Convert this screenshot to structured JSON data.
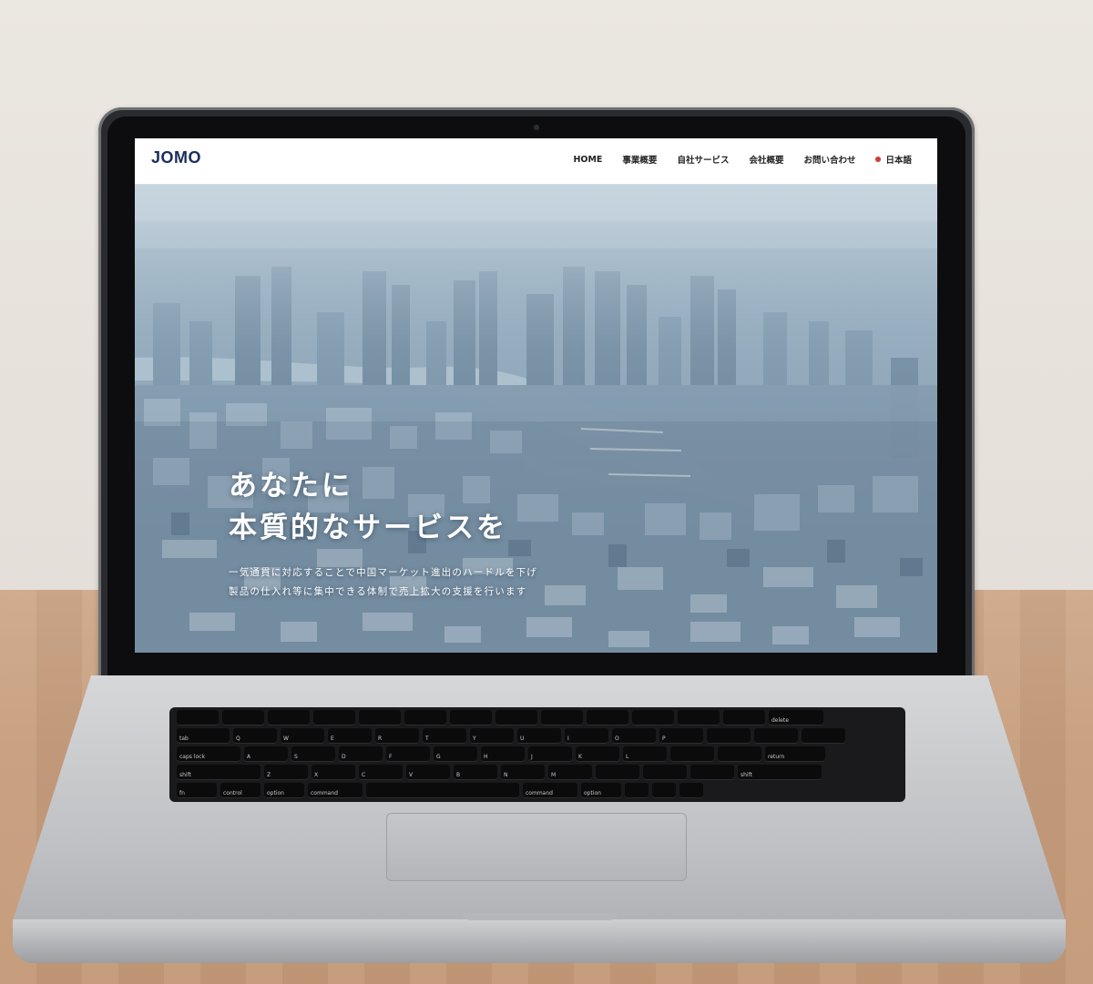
{
  "site": {
    "logo": "JOMO",
    "nav": [
      {
        "label": "HOME"
      },
      {
        "label": "事業概要"
      },
      {
        "label": "自社サービス"
      },
      {
        "label": "会社概要"
      },
      {
        "label": "お問い合わせ"
      }
    ],
    "language": {
      "label": "日本語",
      "flag_icon": "japan-flag-icon"
    }
  },
  "hero": {
    "title_line1": "あなたに",
    "title_line2": "本質的なサービスを",
    "subtitle_line1": "一気通貫に対応することで中国マーケット進出のハードルを下げ",
    "subtitle_line2": "製品の仕入れ等に集中できる体制で売上拡大の支援を行います"
  },
  "keyboard": {
    "row1": [
      "",
      "",
      "",
      "",
      "",
      "",
      "",
      "",
      "",
      "",
      "",
      "",
      "",
      "delete"
    ],
    "row2": [
      "tab",
      "Q",
      "W",
      "E",
      "R",
      "T",
      "Y",
      "U",
      "I",
      "O",
      "P",
      "",
      "",
      ""
    ],
    "row3": [
      "caps lock",
      "A",
      "S",
      "D",
      "F",
      "G",
      "H",
      "J",
      "K",
      "L",
      "",
      "",
      "return"
    ],
    "row4": [
      "shift",
      "Z",
      "X",
      "C",
      "V",
      "B",
      "N",
      "M",
      "",
      "",
      "",
      "shift"
    ],
    "row5": [
      "fn",
      "control",
      "option",
      "command",
      "",
      "command",
      "option",
      "",
      "",
      ""
    ]
  },
  "colors": {
    "brand": "#1b2d5c",
    "accent_flag": "#d63a3a"
  }
}
